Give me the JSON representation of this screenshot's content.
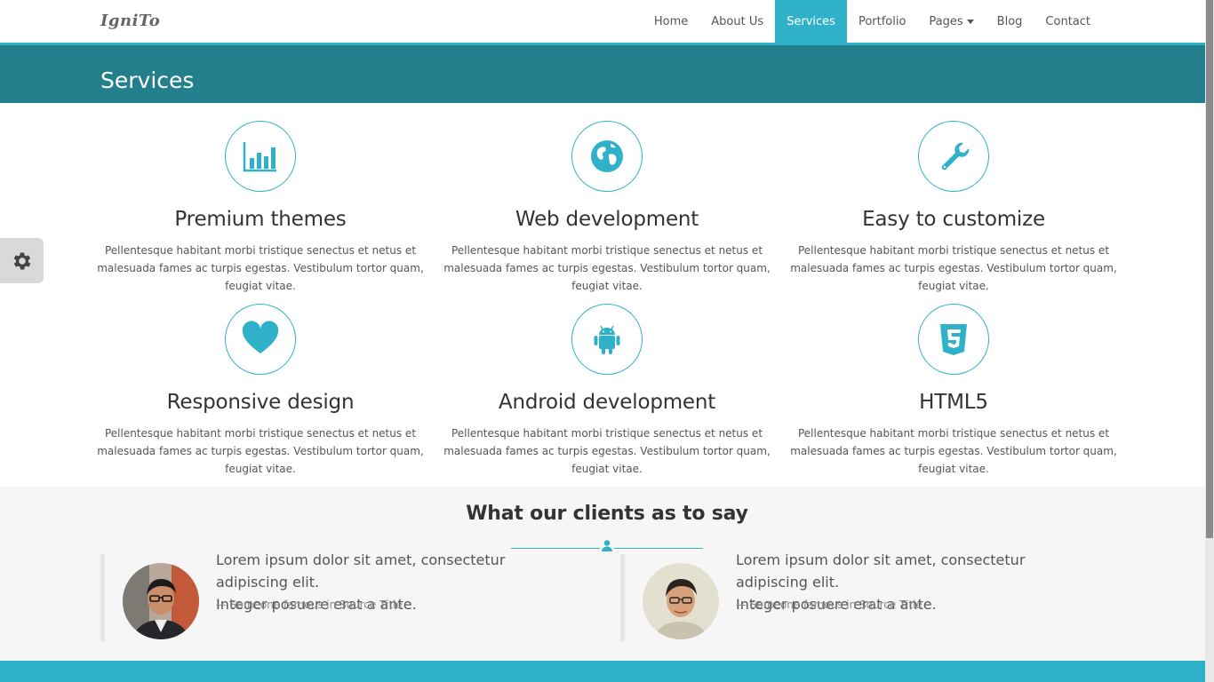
{
  "brand": "IgniTo",
  "nav": {
    "items": [
      {
        "label": "Home"
      },
      {
        "label": "About Us"
      },
      {
        "label": "Services",
        "active": true
      },
      {
        "label": "Portfolio"
      },
      {
        "label": "Pages",
        "dropdown": true
      },
      {
        "label": "Blog"
      },
      {
        "label": "Contact"
      }
    ]
  },
  "page": {
    "title": "Services"
  },
  "services": [
    {
      "icon": "bar-chart-icon",
      "title": "Premium themes",
      "text": "Pellentesque habitant morbi tristique senectus et netus et malesuada fames ac turpis egestas. Vestibulum tortor quam, feugiat vitae."
    },
    {
      "icon": "globe-icon",
      "title": "Web development",
      "text": "Pellentesque habitant morbi tristique senectus et netus et malesuada fames ac turpis egestas. Vestibulum tortor quam, feugiat vitae."
    },
    {
      "icon": "wrench-icon",
      "title": "Easy to customize",
      "text": "Pellentesque habitant morbi tristique senectus et netus et malesuada fames ac turpis egestas. Vestibulum tortor quam, feugiat vitae."
    },
    {
      "icon": "heart-icon",
      "title": "Responsive design",
      "text": "Pellentesque habitant morbi tristique senectus et netus et malesuada fames ac turpis egestas. Vestibulum tortor quam, feugiat vitae."
    },
    {
      "icon": "android-icon",
      "title": "Android development",
      "text": "Pellentesque habitant morbi tristique senectus et netus et malesuada fames ac turpis egestas. Vestibulum tortor quam, feugiat vitae."
    },
    {
      "icon": "html5-icon",
      "title": "HTML5",
      "text": "Pellentesque habitant morbi tristique senectus et netus et malesuada fames ac turpis egestas. Vestibulum tortor quam, feugiat vitae."
    }
  ],
  "testimonials": {
    "title": "What our clients as to say",
    "quotes": [
      {
        "text_1": "Lorem ipsum dolor sit amet, consectetur adipiscing elit.",
        "text_2": "Integer posuere erat a ante.",
        "cite": "— Someone famous in Source Title"
      },
      {
        "text_1": "Lorem ipsum dolor sit amet, consectetur adipiscing elit.",
        "text_2": "Integer posuere erat a ante.",
        "cite": "— Someone famous in Source Title"
      }
    ]
  },
  "colors": {
    "accent": "#2fb2c9",
    "header_bg": "#247f8c",
    "testimonial_bg": "#f6f6f6"
  }
}
